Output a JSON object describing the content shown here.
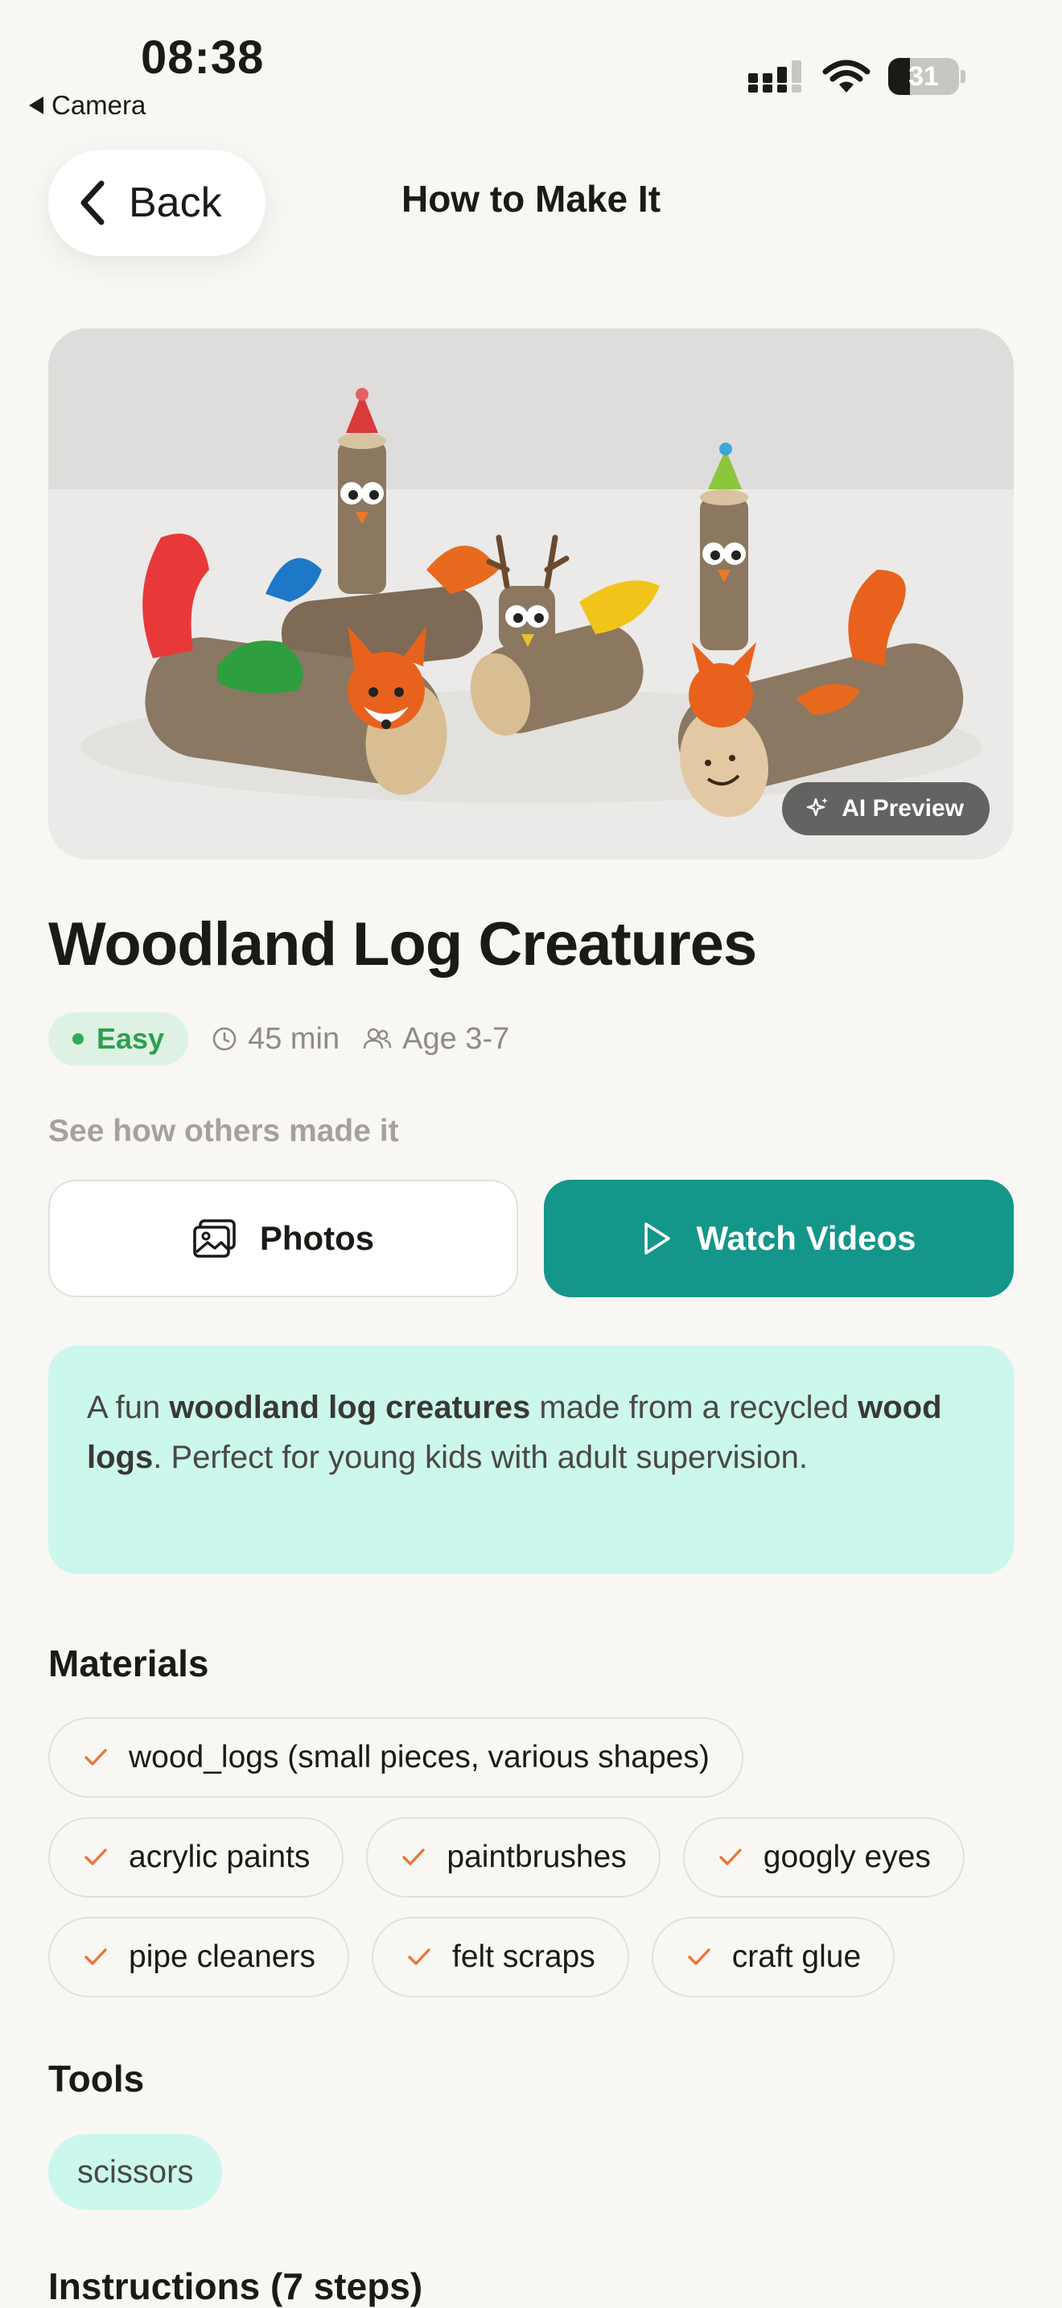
{
  "status_bar": {
    "time": "08:38",
    "back_app": "Camera",
    "battery": "31",
    "battery_level": 0.31
  },
  "header": {
    "back_label": "Back",
    "title": "How to Make It"
  },
  "hero": {
    "badge": "AI Preview"
  },
  "craft": {
    "title": "Woodland Log Creatures",
    "difficulty": "Easy",
    "duration": "45 min",
    "age": "Age 3-7"
  },
  "others": {
    "heading": "See how others made it",
    "photos_label": "Photos",
    "videos_label": "Watch Videos"
  },
  "description": {
    "p1": "A fun ",
    "b1": "woodland log creatures",
    "p2": " made from a recycled ",
    "b2": "wood logs",
    "p3": ". Perfect for young kids with adult supervision."
  },
  "materials": {
    "heading": "Materials",
    "items": [
      "wood_logs (small pieces, various shapes)",
      "acrylic paints",
      "paintbrushes",
      "googly eyes",
      "pipe cleaners",
      "felt scraps",
      "craft glue"
    ]
  },
  "tools": {
    "heading": "Tools",
    "items": [
      "scissors"
    ]
  },
  "instructions": {
    "heading": "Instructions (7 steps)"
  },
  "colors": {
    "accent": "#14968A",
    "easy_green": "#2E9E4F",
    "check_orange": "#E8763A",
    "mint": "#CCF7EC"
  },
  "icons": {
    "back": "chevron-left-icon",
    "clock": "clock-icon",
    "age": "users-icon",
    "photos": "photos-icon",
    "play": "play-icon",
    "check": "check-icon",
    "sparkle": "sparkle-icon"
  }
}
